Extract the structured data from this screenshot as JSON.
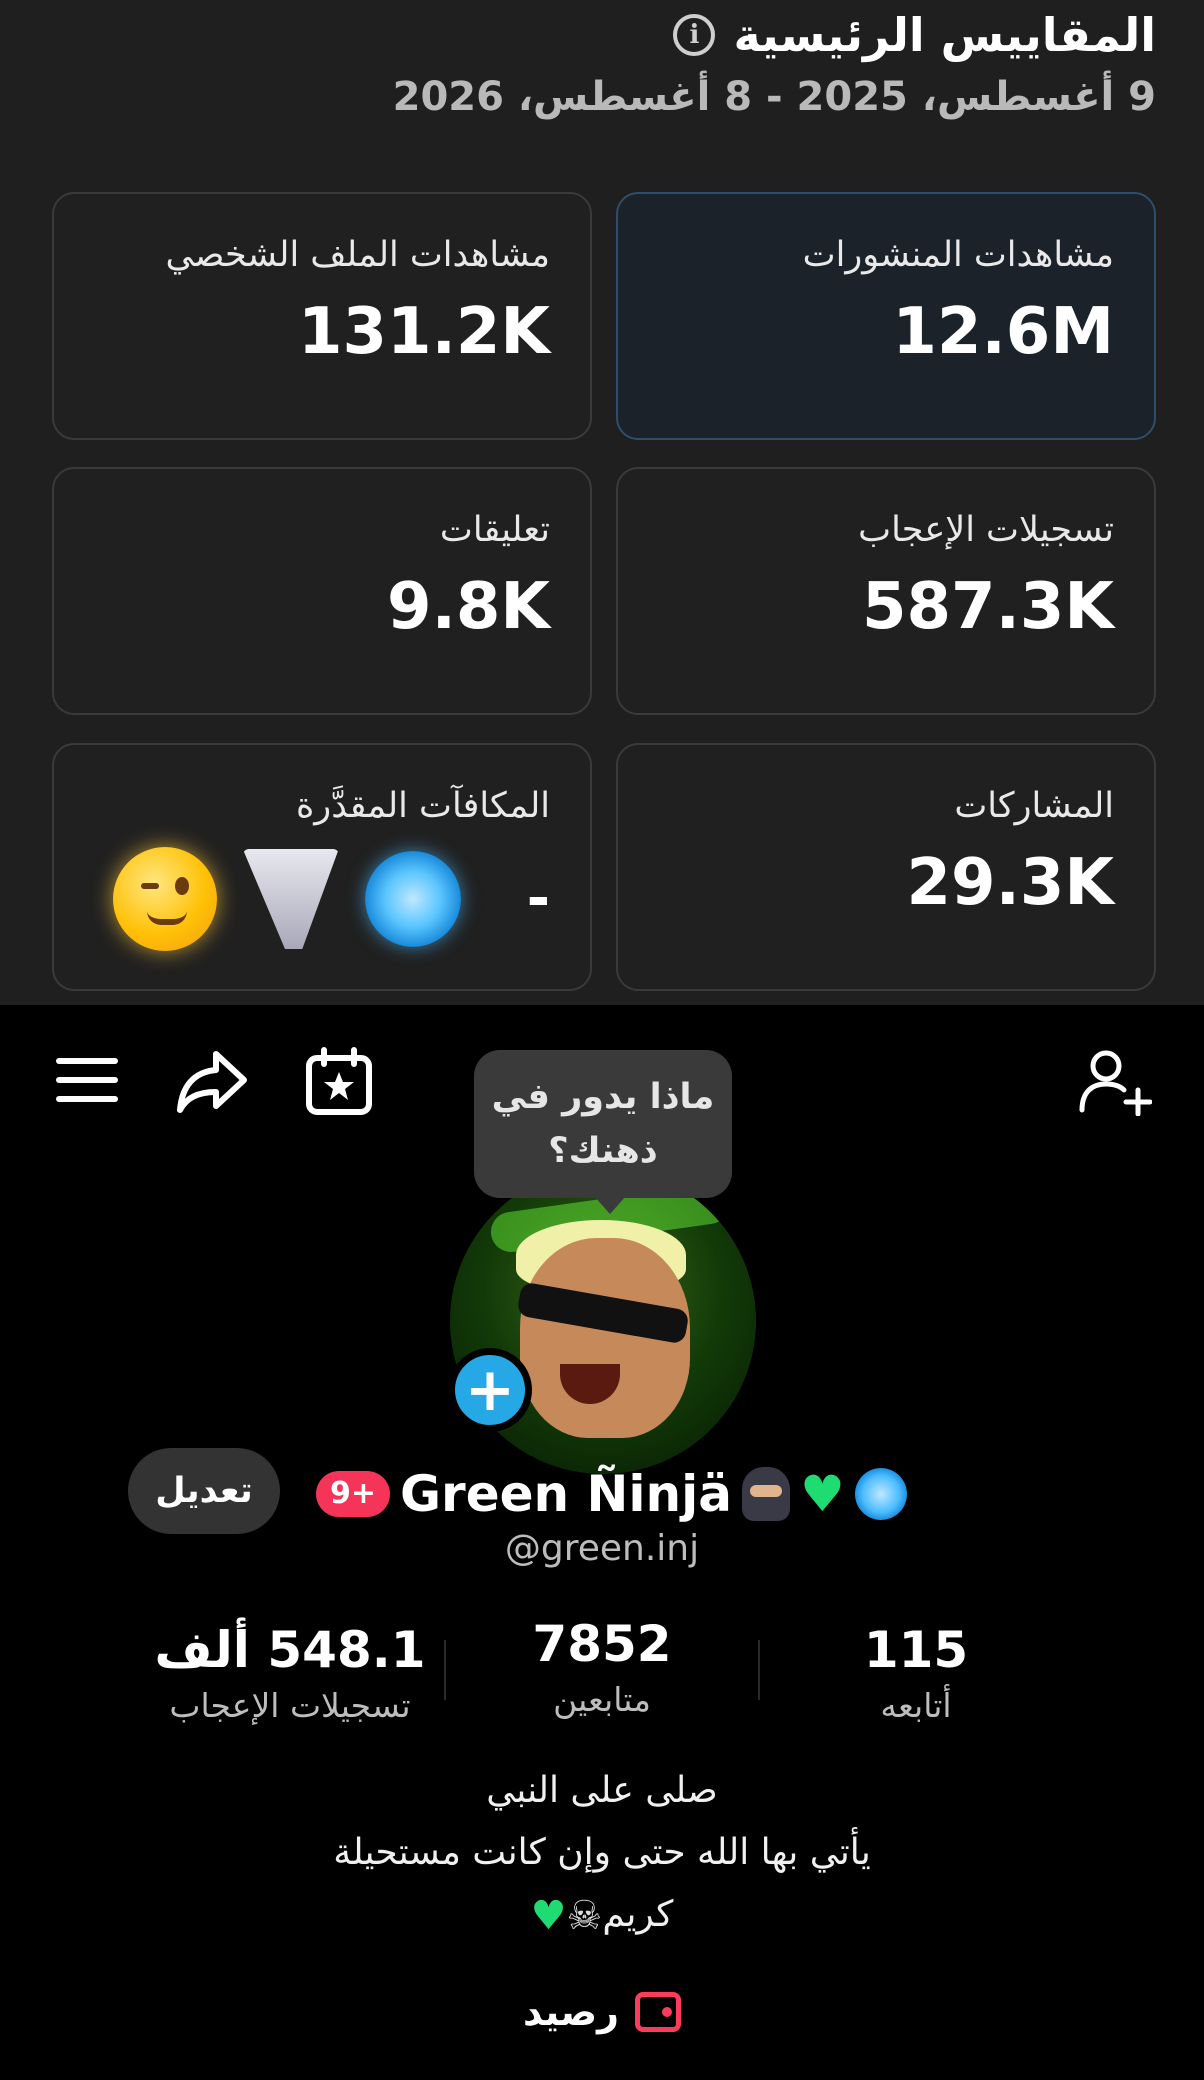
{
  "metrics": {
    "title": "المقاييس الرئيسية",
    "date_range": "9 أغسطس، 2025 - 8 أغسطس، 2026",
    "cards": [
      {
        "label": "مشاهدات المنشورات",
        "value": "12.6M"
      },
      {
        "label": "مشاهدات الملف الشخصي",
        "value": "131.2K"
      },
      {
        "label": "تسجيلات الإعجاب",
        "value": "587.3K"
      },
      {
        "label": "تعليقات",
        "value": "9.8K"
      },
      {
        "label": "المشاركات",
        "value": "29.3K"
      },
      {
        "label": "المكافآت المقدَّرة",
        "value": "-"
      }
    ],
    "selected_card": 0,
    "reward_emojis": [
      "fingerprint-emoji",
      "tornado-emoji",
      "winking-face-emoji"
    ]
  },
  "profile": {
    "thought_bubble": "ماذا يدور في ذهنك؟",
    "notification_badge": "9+",
    "display_name": "Green Ñinjä",
    "name_emojis": [
      "ninja-emoji",
      "green-heart-emoji",
      "fingerprint-emoji"
    ],
    "handle": "@green.inj",
    "edit_label": "تعديل",
    "stats": {
      "following_value": "115",
      "following_label": "أتابعه",
      "followers_value": "7852",
      "followers_label": "متابعين",
      "likes_value": "548.1 ألف",
      "likes_label": "تسجيلات الإعجاب"
    },
    "bio": {
      "line1": "صلى على النبي",
      "line2": "يأتي بها الله حتى وإن كانت مستحيلة",
      "line3": "كريم"
    },
    "wallet_label": "رصيد"
  },
  "colors": {
    "accent_blue": "#27a8e6",
    "badge_red": "#f5345a",
    "heart_green": "#1fdc72"
  }
}
